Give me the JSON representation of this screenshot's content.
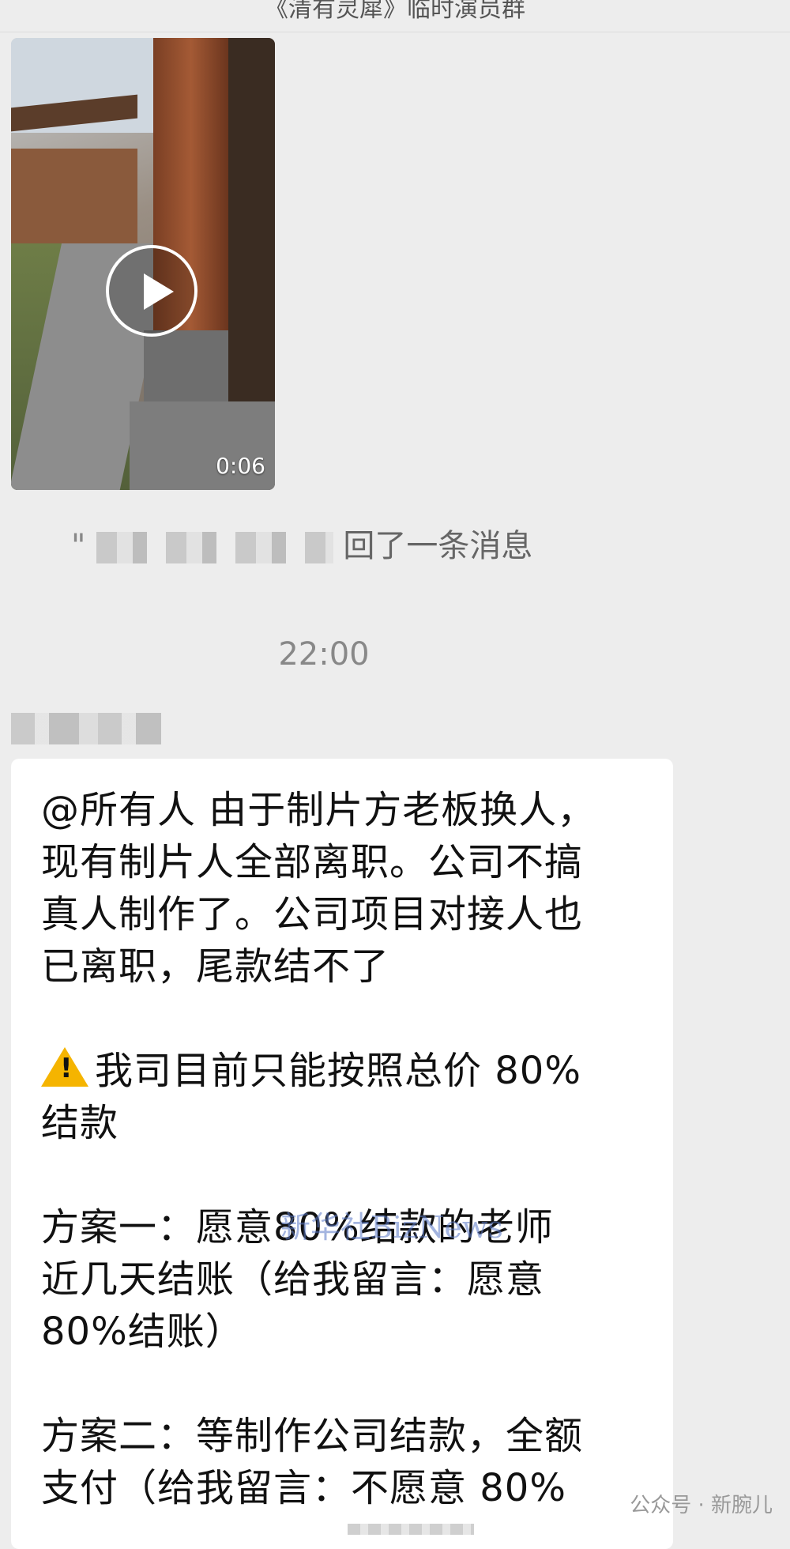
{
  "header": {
    "title": "《清有灵犀》临时演员群"
  },
  "video_message": {
    "duration": "0:06"
  },
  "recall_notice": {
    "quote_mark": "\"",
    "text": "回了一条消息"
  },
  "timestamp": "22:00",
  "message": {
    "lines": [
      "@所有人 由于制片方老板换人，",
      "现有制片人全部离职。公司不搞",
      "真人制作了。公司项目对接人也",
      "已离职，尾款结不了",
      "",
      "我司目前只能按照总价 80%",
      "结款",
      "",
      "方案一：愿意80%结款的老师",
      "近几天结账（给我留言：愿意",
      "80%结账）",
      "",
      "方案二：等制作公司结款，全额",
      "支付（给我留言：不愿意 80%"
    ]
  },
  "watermarks": {
    "overlay": "新华社BizNews",
    "footer": "公众号 · 新腕儿"
  }
}
